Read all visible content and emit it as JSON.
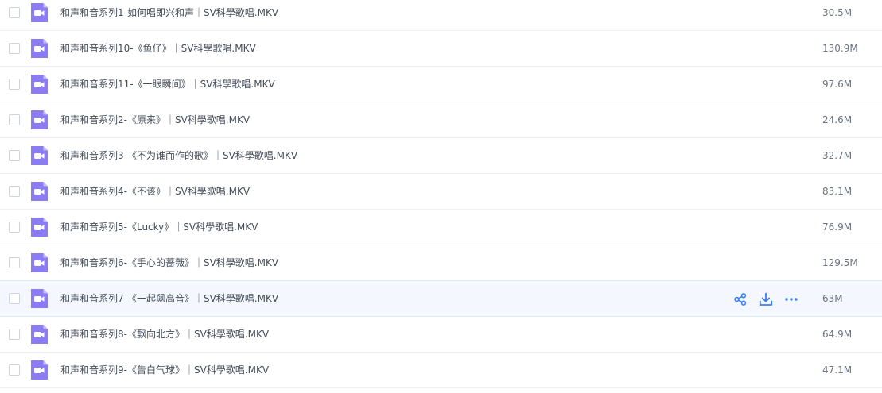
{
  "colors": {
    "icon_purple": "#8b7cf4",
    "action_blue": "#3c7ff0",
    "hover_background": "#f4f8fe"
  },
  "files": [
    {
      "name": "和声和音系列1-如何唱即兴和声｜SV科學歌唱.MKV",
      "size": "30.5M"
    },
    {
      "name": "和声和音系列10-《鱼仔》｜SV科學歌唱.MKV",
      "size": "130.9M"
    },
    {
      "name": "和声和音系列11-《一眼瞬间》｜SV科學歌唱.MKV",
      "size": "97.6M"
    },
    {
      "name": "和声和音系列2-《原来》｜SV科學歌唱.MKV",
      "size": "24.6M"
    },
    {
      "name": "和声和音系列3-《不为谁而作的歌》｜SV科學歌唱.MKV",
      "size": "32.7M"
    },
    {
      "name": "和声和音系列4-《不该》｜SV科學歌唱.MKV",
      "size": "83.1M"
    },
    {
      "name": "和声和音系列5-《Lucky》｜SV科學歌唱.MKV",
      "size": "76.9M"
    },
    {
      "name": "和声和音系列6-《手心的蔷薇》｜SV科學歌唱.MKV",
      "size": "129.5M"
    },
    {
      "name": "和声和音系列7-《一起飙高音》｜SV科學歌唱.MKV",
      "size": "63M"
    },
    {
      "name": "和声和音系列8-《飘向北方》｜SV科學歌唱.MKV",
      "size": "64.9M"
    },
    {
      "name": "和声和音系列9-《告白气球》｜SV科學歌唱.MKV",
      "size": "47.1M"
    }
  ],
  "hover_row_actions": [
    "share-icon",
    "download-icon",
    "more-icon"
  ]
}
